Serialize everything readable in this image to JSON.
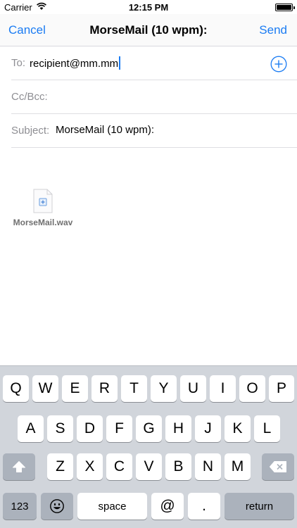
{
  "status_bar": {
    "carrier": "Carrier",
    "time": "12:15 PM",
    "icons": [
      "wifi-icon",
      "battery-icon"
    ]
  },
  "nav": {
    "cancel_label": "Cancel",
    "title": "MorseMail (10 wpm):",
    "send_label": "Send"
  },
  "compose": {
    "to_label": "To:",
    "to_value": "recipient@mm.mm",
    "cc_label": "Cc/Bcc:",
    "subject_label": "Subject:",
    "subject_value": "MorseMail (10 wpm):",
    "add_contact_icon": "plus-circle-icon"
  },
  "attachment": {
    "filename": "MorseMail.wav",
    "icon": "audio-file-icon"
  },
  "keyboard": {
    "row1": [
      "Q",
      "W",
      "E",
      "R",
      "T",
      "Y",
      "U",
      "I",
      "O",
      "P"
    ],
    "row2": [
      "A",
      "S",
      "D",
      "F",
      "G",
      "H",
      "J",
      "K",
      "L"
    ],
    "row3": [
      "Z",
      "X",
      "C",
      "V",
      "B",
      "N",
      "M"
    ],
    "shift_icon": "shift-icon",
    "delete_icon": "delete-icon",
    "numbers_label": "123",
    "emoji_icon": "emoji-icon",
    "space_label": "space",
    "at_label": "@",
    "dot_label": ".",
    "return_label": "return"
  },
  "colors": {
    "accent": "#1b7cf3",
    "label_gray": "#8e8e93",
    "keyboard_bg": "#d1d5db",
    "key_dark": "#abb2bc"
  }
}
